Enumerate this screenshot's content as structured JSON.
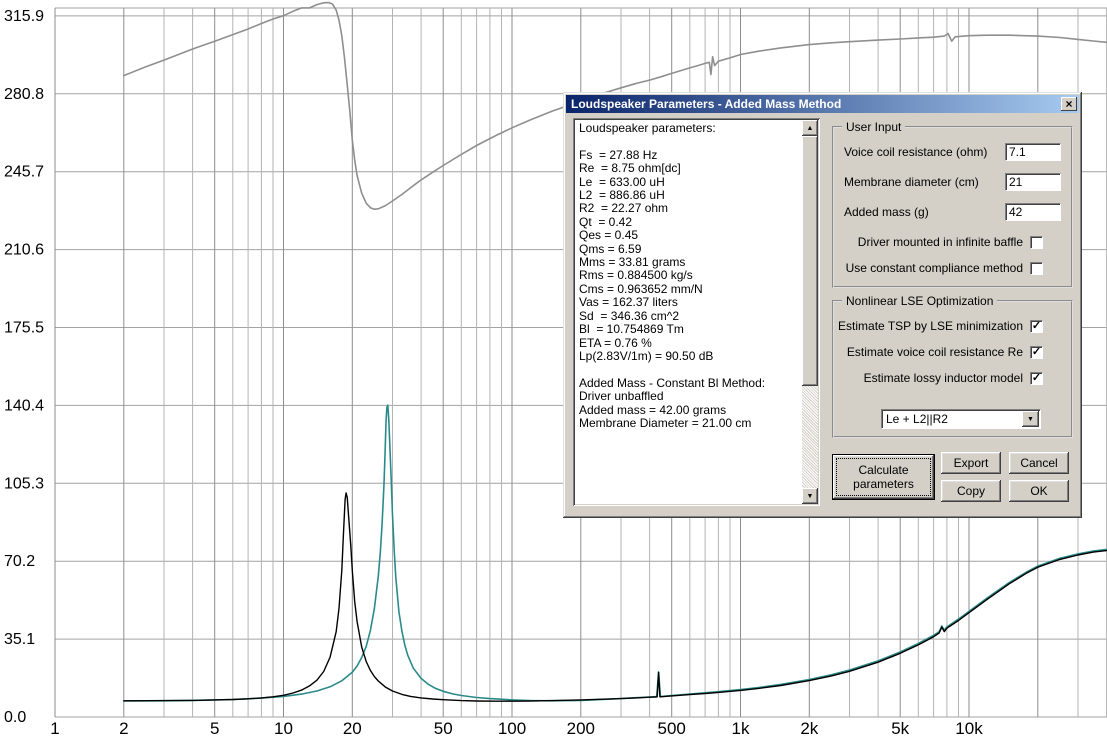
{
  "dialog": {
    "title": "Loudspeaker Parameters - Added Mass Method",
    "close_glyph": "×"
  },
  "icons": {
    "scroll_up": "▲",
    "scroll_down": "▼",
    "dropdown_arrow": "▼",
    "check": "✓"
  },
  "params_panel": {
    "lines": [
      "Loudspeaker parameters:",
      "",
      "Fs  = 27.88 Hz",
      "Re  = 8.75 ohm[dc]",
      "Le  = 633.00 uH",
      "L2  = 886.86 uH",
      "R2  = 22.27 ohm",
      "Qt  = 0.42",
      "Qes = 0.45",
      "Qms = 6.59",
      "Mms = 33.81 grams",
      "Rms = 0.884500 kg/s",
      "Cms = 0.963652 mm/N",
      "Vas = 162.37 liters",
      "Sd  = 346.36 cm^2",
      "Bl  = 10.754869 Tm",
      "ETA = 0.76 %",
      "Lp(2.83V/1m) = 90.50 dB",
      "",
      "Added Mass - Constant Bl Method:",
      "Driver unbaffled",
      "Added mass = 42.00 grams",
      "Membrane Diameter = 21.00 cm"
    ]
  },
  "user_input": {
    "title": "User Input",
    "fields": [
      {
        "label": "Voice coil resistance (ohm)",
        "value": "7.1"
      },
      {
        "label": "Membrane diameter (cm)",
        "value": "21"
      },
      {
        "label": "Added mass (g)",
        "value": "42"
      }
    ],
    "checkboxes": [
      {
        "label": "Driver mounted in infinite baffle",
        "checked": false
      },
      {
        "label": "Use constant compliance method",
        "checked": false
      }
    ]
  },
  "lse": {
    "title": "Nonlinear LSE Optimization",
    "checkboxes": [
      {
        "label": "Estimate TSP by LSE minimization",
        "checked": true
      },
      {
        "label": "Estimate voice coil resistance Re",
        "checked": true
      },
      {
        "label": "Estimate lossy inductor model",
        "checked": true
      }
    ],
    "dropdown": {
      "value": "Le + L2||R2"
    }
  },
  "buttons": {
    "calculate": "Calculate parameters",
    "export": "Export",
    "cancel": "Cancel",
    "copy": "Copy",
    "ok": "OK"
  },
  "chart_data": {
    "type": "line",
    "x_scale": "log",
    "x_range": [
      1,
      40000
    ],
    "y_range": [
      0,
      319.5
    ],
    "grid": true,
    "x_ticks": [
      {
        "f": 1,
        "label": "1"
      },
      {
        "f": 2,
        "label": "2"
      },
      {
        "f": 5,
        "label": "5"
      },
      {
        "f": 10,
        "label": "10"
      },
      {
        "f": 20,
        "label": "20"
      },
      {
        "f": 50,
        "label": "50"
      },
      {
        "f": 100,
        "label": "100"
      },
      {
        "f": 200,
        "label": "200"
      },
      {
        "f": 500,
        "label": "500"
      },
      {
        "f": 1000,
        "label": "1k"
      },
      {
        "f": 2000,
        "label": "2k"
      },
      {
        "f": 5000,
        "label": "5k"
      },
      {
        "f": 10000,
        "label": "10k"
      }
    ],
    "y_ticks": [
      {
        "v": 0,
        "label": "0.0"
      },
      {
        "v": 35.1,
        "label": "35.1"
      },
      {
        "v": 70.2,
        "label": "70.2"
      },
      {
        "v": 105.3,
        "label": "105.3"
      },
      {
        "v": 140.4,
        "label": "140.4"
      },
      {
        "v": 175.5,
        "label": "175.5"
      },
      {
        "v": 210.6,
        "label": "210.6"
      },
      {
        "v": 245.7,
        "label": "245.7"
      },
      {
        "v": 280.8,
        "label": "280.8"
      },
      {
        "v": 315.9,
        "label": "315.9"
      }
    ],
    "series": [
      {
        "name": "phase-reference",
        "color": "#8f8f8f",
        "width": 1.6,
        "points": [
          [
            2,
            289
          ],
          [
            2.5,
            293
          ],
          [
            3,
            296
          ],
          [
            4,
            301
          ],
          [
            5,
            304.5
          ],
          [
            6,
            307.5
          ],
          [
            7,
            310
          ],
          [
            8,
            312.5
          ],
          [
            9,
            314.5
          ],
          [
            10,
            316
          ],
          [
            11,
            318
          ],
          [
            12,
            319.5
          ],
          [
            13,
            319.5
          ],
          [
            14,
            321
          ],
          [
            15,
            321.8
          ],
          [
            15.8,
            321.9
          ],
          [
            16.4,
            321.2
          ],
          [
            17,
            318.5
          ],
          [
            17.5,
            314
          ],
          [
            18,
            307
          ],
          [
            18.5,
            297
          ],
          [
            19,
            285
          ],
          [
            19.5,
            273
          ],
          [
            20,
            260
          ],
          [
            20.5,
            251
          ],
          [
            21,
            244
          ],
          [
            22,
            236
          ],
          [
            23,
            231.5
          ],
          [
            24,
            229.5
          ],
          [
            25,
            228.8
          ],
          [
            26,
            229
          ],
          [
            28,
            230.5
          ],
          [
            30,
            232.5
          ],
          [
            33,
            235.5
          ],
          [
            36,
            238.5
          ],
          [
            40,
            242
          ],
          [
            45,
            245.5
          ],
          [
            50,
            248.5
          ],
          [
            60,
            253.5
          ],
          [
            70,
            257.5
          ],
          [
            85,
            262
          ],
          [
            100,
            265.5
          ],
          [
            120,
            269
          ],
          [
            150,
            273
          ],
          [
            200,
            277.5
          ],
          [
            250,
            281
          ],
          [
            300,
            283.5
          ],
          [
            350,
            285.5
          ],
          [
            400,
            287
          ],
          [
            450,
            288.5
          ],
          [
            500,
            290
          ],
          [
            600,
            292.5
          ],
          [
            650,
            293.5
          ],
          [
            700,
            294.5
          ],
          [
            730,
            295
          ],
          [
            742,
            289.5
          ],
          [
            755,
            297.5
          ],
          [
            770,
            293.5
          ],
          [
            800,
            295.5
          ],
          [
            900,
            297
          ],
          [
            1000,
            298.5
          ],
          [
            1200,
            300
          ],
          [
            1500,
            301.5
          ],
          [
            2000,
            303
          ],
          [
            2500,
            303.8
          ],
          [
            3000,
            304.3
          ],
          [
            4000,
            305
          ],
          [
            5000,
            305.5
          ],
          [
            6000,
            306
          ],
          [
            7000,
            306.3
          ],
          [
            7800,
            306.8
          ],
          [
            8100,
            308
          ],
          [
            8400,
            304.5
          ],
          [
            8700,
            306.5
          ],
          [
            9500,
            306.8
          ],
          [
            10000,
            307
          ],
          [
            12000,
            307.2
          ],
          [
            15000,
            307.2
          ],
          [
            20000,
            306.8
          ],
          [
            25000,
            306.2
          ],
          [
            30000,
            305.3
          ],
          [
            35000,
            304.6
          ],
          [
            40000,
            304
          ]
        ]
      },
      {
        "name": "impedance-free-air",
        "color": "#2a8a8a",
        "width": 1.6,
        "points": [
          [
            2,
            7.2
          ],
          [
            3,
            7.3
          ],
          [
            4,
            7.5
          ],
          [
            5,
            7.7
          ],
          [
            6,
            7.9
          ],
          [
            7,
            8.2
          ],
          [
            8,
            8.5
          ],
          [
            9,
            8.9
          ],
          [
            10,
            9.3
          ],
          [
            12,
            10.3
          ],
          [
            14,
            11.7
          ],
          [
            16,
            13.6
          ],
          [
            18,
            16.3
          ],
          [
            20,
            20.2
          ],
          [
            21,
            23
          ],
          [
            22,
            26.8
          ],
          [
            23,
            31.8
          ],
          [
            24,
            39
          ],
          [
            25,
            49
          ],
          [
            26,
            63.5
          ],
          [
            26.5,
            73.5
          ],
          [
            27,
            87
          ],
          [
            27.5,
            104
          ],
          [
            27.8,
            118
          ],
          [
            28.1,
            133
          ],
          [
            28.35,
            139.5
          ],
          [
            28.6,
            140.5
          ],
          [
            28.9,
            134
          ],
          [
            29.2,
            123
          ],
          [
            29.6,
            107
          ],
          [
            30,
            91
          ],
          [
            30.5,
            75
          ],
          [
            31,
            63
          ],
          [
            32,
            47.5
          ],
          [
            33,
            38.5
          ],
          [
            34,
            32.2
          ],
          [
            35,
            27.8
          ],
          [
            37,
            22
          ],
          [
            40,
            17.4
          ],
          [
            43,
            14.8
          ],
          [
            46,
            13
          ],
          [
            50,
            11.6
          ],
          [
            55,
            10.4
          ],
          [
            60,
            9.7
          ],
          [
            70,
            8.8
          ],
          [
            80,
            8.3
          ],
          [
            100,
            7.7
          ],
          [
            120,
            7.4
          ],
          [
            150,
            7.3
          ],
          [
            200,
            7.5
          ],
          [
            250,
            7.9
          ],
          [
            300,
            8.3
          ],
          [
            350,
            8.7
          ],
          [
            400,
            9
          ],
          [
            430,
            9.2
          ],
          [
            438,
            20.3
          ],
          [
            446,
            9.2
          ],
          [
            500,
            9.7
          ],
          [
            600,
            10.3
          ],
          [
            700,
            10.9
          ],
          [
            800,
            11.4
          ],
          [
            1000,
            12.4
          ],
          [
            1200,
            13.3
          ],
          [
            1500,
            14.7
          ],
          [
            2000,
            16.9
          ],
          [
            2500,
            19
          ],
          [
            3000,
            21.2
          ],
          [
            4000,
            25.3
          ],
          [
            5000,
            29.3
          ],
          [
            6000,
            33.1
          ],
          [
            7000,
            36.8
          ],
          [
            7400,
            38.4
          ],
          [
            7600,
            41
          ],
          [
            7800,
            39.1
          ],
          [
            8000,
            40.6
          ],
          [
            9000,
            44.1
          ],
          [
            10000,
            47.6
          ],
          [
            12000,
            53.6
          ],
          [
            15000,
            60.6
          ],
          [
            18000,
            65.5
          ],
          [
            20000,
            68
          ],
          [
            25000,
            71.5
          ],
          [
            30000,
            73.5
          ],
          [
            35000,
            74.8
          ],
          [
            40000,
            75.5
          ]
        ]
      },
      {
        "name": "impedance-added-mass",
        "color": "#000000",
        "width": 1.4,
        "points": [
          [
            2,
            7.3
          ],
          [
            3,
            7.4
          ],
          [
            4,
            7.5
          ],
          [
            5,
            7.7
          ],
          [
            6,
            7.9
          ],
          [
            7,
            8.2
          ],
          [
            8,
            8.6
          ],
          [
            9,
            9.1
          ],
          [
            10,
            9.8
          ],
          [
            11,
            10.8
          ],
          [
            12,
            12.1
          ],
          [
            13,
            14
          ],
          [
            14,
            16.6
          ],
          [
            15,
            20.5
          ],
          [
            16,
            27
          ],
          [
            17,
            38.5
          ],
          [
            17.5,
            49
          ],
          [
            18,
            66
          ],
          [
            18.3,
            83
          ],
          [
            18.6,
            98
          ],
          [
            18.8,
            101
          ],
          [
            19,
            99
          ],
          [
            19.3,
            90
          ],
          [
            19.7,
            77
          ],
          [
            20,
            66
          ],
          [
            20.5,
            52
          ],
          [
            21,
            43
          ],
          [
            22,
            31.5
          ],
          [
            23,
            25
          ],
          [
            24,
            21
          ],
          [
            25,
            18.2
          ],
          [
            26,
            16.2
          ],
          [
            28,
            13.4
          ],
          [
            30,
            11.7
          ],
          [
            33,
            10.2
          ],
          [
            36,
            9.3
          ],
          [
            40,
            8.6
          ],
          [
            45,
            8.1
          ],
          [
            50,
            7.8
          ],
          [
            60,
            7.4
          ],
          [
            70,
            7.2
          ],
          [
            85,
            7.1
          ],
          [
            100,
            7.1
          ],
          [
            120,
            7.2
          ],
          [
            150,
            7.4
          ],
          [
            200,
            7.7
          ],
          [
            250,
            8
          ],
          [
            300,
            8.3
          ],
          [
            350,
            8.6
          ],
          [
            400,
            8.9
          ],
          [
            425,
            9
          ],
          [
            432,
            9.1
          ],
          [
            438,
            20
          ],
          [
            444,
            9.1
          ],
          [
            460,
            9.2
          ],
          [
            500,
            9.5
          ],
          [
            600,
            10.1
          ],
          [
            700,
            10.6
          ],
          [
            800,
            11.1
          ],
          [
            1000,
            12
          ],
          [
            1200,
            12.9
          ],
          [
            1500,
            14.2
          ],
          [
            2000,
            16.4
          ],
          [
            2500,
            18.5
          ],
          [
            3000,
            20.6
          ],
          [
            4000,
            24.7
          ],
          [
            5000,
            28.7
          ],
          [
            6000,
            32.5
          ],
          [
            7000,
            36.2
          ],
          [
            7400,
            37.8
          ],
          [
            7600,
            40.5
          ],
          [
            7800,
            38.5
          ],
          [
            8000,
            40
          ],
          [
            9000,
            43.5
          ],
          [
            10000,
            47
          ],
          [
            12000,
            53
          ],
          [
            15000,
            60
          ],
          [
            18000,
            65
          ],
          [
            20000,
            67.5
          ],
          [
            25000,
            71
          ],
          [
            30000,
            73
          ],
          [
            35000,
            74.3
          ],
          [
            40000,
            75
          ]
        ]
      }
    ]
  }
}
